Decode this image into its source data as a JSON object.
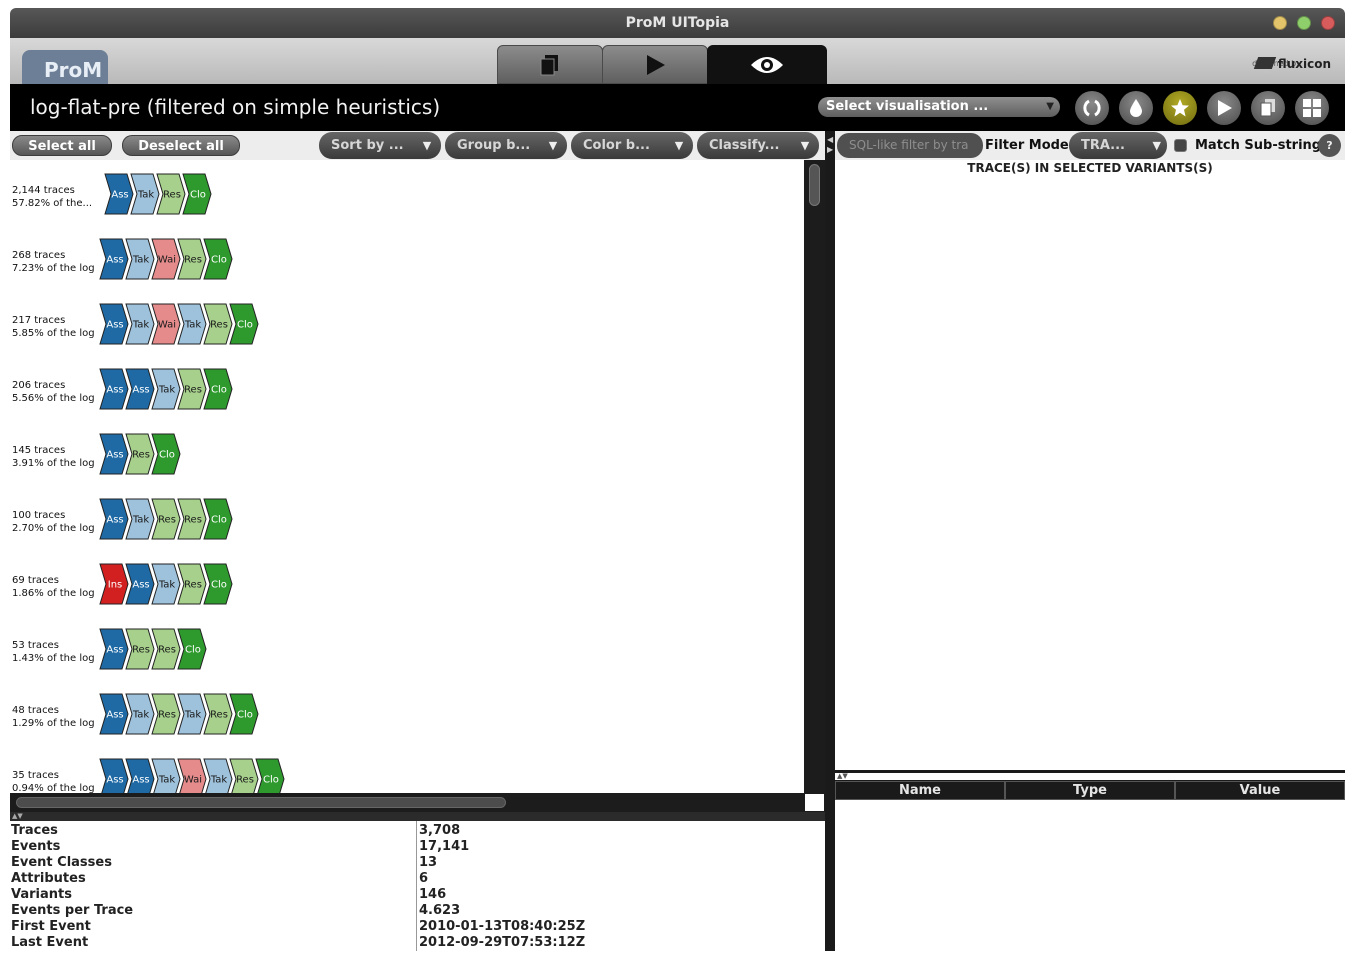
{
  "window": {
    "title": "ProM UITopia",
    "buttons": {
      "minimize_color": "#e3c46a",
      "maximize_color": "#8fcf6b",
      "close_color": "#d95c5c"
    }
  },
  "prom_bar": {
    "logo": "ProM",
    "tabs": [
      {
        "icon": "workspace-icon"
      },
      {
        "icon": "action-play-icon"
      },
      {
        "icon": "view-eye-icon",
        "active": true
      }
    ],
    "designed_by": "designed by",
    "brand": "fluxicon"
  },
  "header": {
    "title": "log-flat-pre (filtered on simple heuristics)",
    "visualisation_select": "Select visualisation ...",
    "round_buttons": [
      "refresh-icon",
      "drop-icon",
      "star-icon",
      "play-icon",
      "copy-icon",
      "grid-icon"
    ]
  },
  "toolbar": {
    "select_all": "Select all",
    "deselect_all": "Deselect all",
    "sort_by": "Sort by ...",
    "group_by": "Group b...",
    "color_by": "Color b...",
    "classify": "Classify..."
  },
  "colors": {
    "Ass": "#1f6aa5",
    "Tak": "#9ec2dc",
    "Wai": "#e58b8b",
    "Res": "#a6d08b",
    "Clo": "#2e9a2e",
    "Ins": "#d21f1f"
  },
  "variants": [
    {
      "count": "2,144 traces",
      "share": "57.82% of the...",
      "events": [
        "Ass",
        "Tak",
        "Res",
        "Clo"
      ]
    },
    {
      "count": "268 traces",
      "share": "7.23% of the log",
      "events": [
        "Ass",
        "Tak",
        "Wai",
        "Res",
        "Clo"
      ]
    },
    {
      "count": "217 traces",
      "share": "5.85% of the log",
      "events": [
        "Ass",
        "Tak",
        "Wai",
        "Tak",
        "Res",
        "Clo"
      ]
    },
    {
      "count": "206 traces",
      "share": "5.56% of the log",
      "events": [
        "Ass",
        "Ass",
        "Tak",
        "Res",
        "Clo"
      ]
    },
    {
      "count": "145 traces",
      "share": "3.91% of the log",
      "events": [
        "Ass",
        "Res",
        "Clo"
      ]
    },
    {
      "count": "100 traces",
      "share": "2.70% of the log",
      "events": [
        "Ass",
        "Tak",
        "Res",
        "Res",
        "Clo"
      ]
    },
    {
      "count": "69 traces",
      "share": "1.86% of the log",
      "events": [
        "Ins",
        "Ass",
        "Tak",
        "Res",
        "Clo"
      ]
    },
    {
      "count": "53 traces",
      "share": "1.43% of the log",
      "events": [
        "Ass",
        "Res",
        "Res",
        "Clo"
      ]
    },
    {
      "count": "48 traces",
      "share": "1.29% of the log",
      "events": [
        "Ass",
        "Tak",
        "Res",
        "Tak",
        "Res",
        "Clo"
      ]
    },
    {
      "count": "35 traces",
      "share": "0.94% of the log",
      "events": [
        "Ass",
        "Ass",
        "Tak",
        "Wai",
        "Tak",
        "Res",
        "Clo"
      ]
    }
  ],
  "stats": [
    {
      "key": "Traces",
      "value": "3,708"
    },
    {
      "key": "Events",
      "value": "17,141"
    },
    {
      "key": "Event Classes",
      "value": "13"
    },
    {
      "key": "Attributes",
      "value": "6"
    },
    {
      "key": "Variants",
      "value": "146"
    },
    {
      "key": "Events per Trace",
      "value": "4.623"
    },
    {
      "key": "First Event",
      "value": "2010-01-13T08:40:25Z"
    },
    {
      "key": "Last Event",
      "value": "2012-09-29T07:53:12Z"
    }
  ],
  "right": {
    "sql_placeholder": "SQL-like filter by tra",
    "filter_mode": "Filter Mode",
    "filter_mode_value": "TRA...",
    "match_substring": "Match Sub-string",
    "help": "?",
    "traces_label": "TRACE(S) IN SELECTED VARIANTS(S)",
    "attr_columns": [
      "Name",
      "Type",
      "Value"
    ]
  }
}
